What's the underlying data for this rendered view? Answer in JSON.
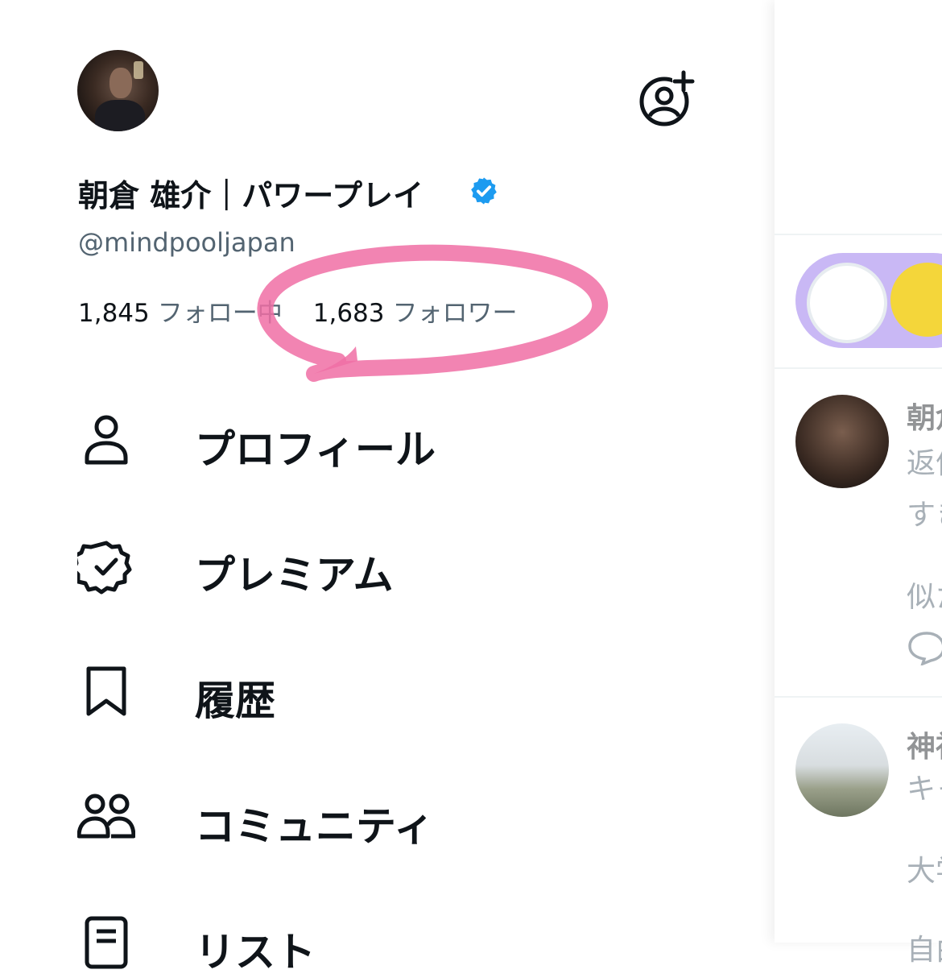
{
  "profile": {
    "name": "朝倉 雄介｜パワープレイ",
    "handle": "@mindpooljapan",
    "following_count": "1,845",
    "following_label": "フォロー中",
    "followers_count": "1,683",
    "followers_label": "フォロワー"
  },
  "menu": [
    {
      "label": "プロフィール",
      "icon": "person-icon"
    },
    {
      "label": "プレミアム",
      "icon": "verified-badge-icon"
    },
    {
      "label": "履歴",
      "icon": "bookmark-icon"
    },
    {
      "label": "コミュニティ",
      "icon": "people-icon"
    },
    {
      "label": "リスト",
      "icon": "list-icon"
    }
  ],
  "timeline": {
    "post1_name": "朝倉",
    "post1_line1": "返信",
    "post1_line2": "すき",
    "post1_line3": "似た",
    "post2_name": "神社",
    "post2_line1": "キャ",
    "post2_line2": "大学",
    "post2_line3": "自由"
  },
  "colors": {
    "accent": "#1d9bf0",
    "annotation": "#f06fa5",
    "spaces_bg": "#c9b8f5"
  }
}
